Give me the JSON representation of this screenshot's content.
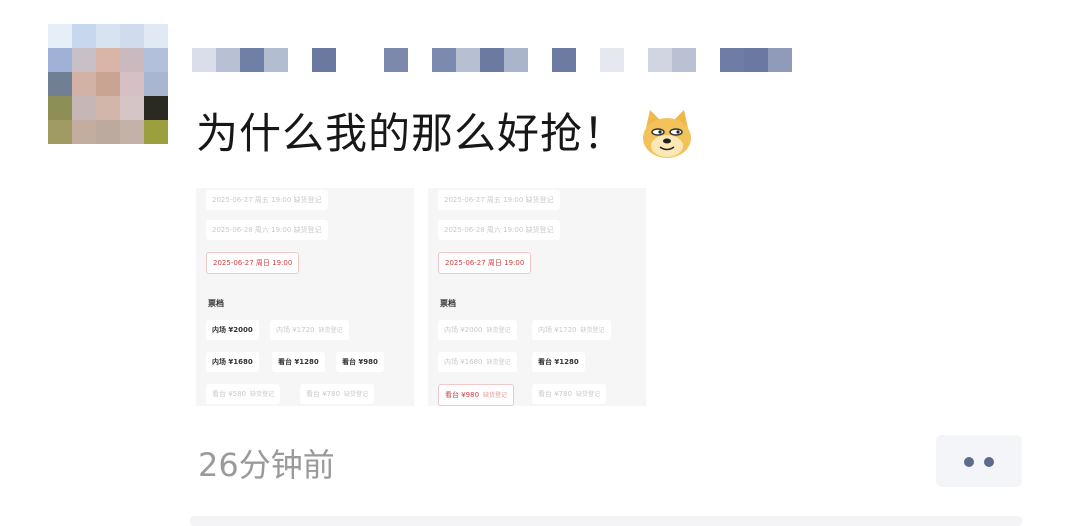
{
  "post": {
    "text": "为什么我的那么好抢！",
    "emoji": "doge-emoji",
    "timestamp": "26分钟前"
  },
  "screenshot_left": {
    "dates": [
      "2025-06-27 周五 19:00 缺货登记",
      "2025-06-28 周六 19:00 缺货登记",
      "2025-06-27 周日 19:00"
    ],
    "section_title": "票档",
    "prices": [
      {
        "label": "内场 ¥2000",
        "tag": ""
      },
      {
        "label": "内场 ¥1720",
        "tag": "缺货登记"
      },
      {
        "label": "内场 ¥1680",
        "tag": ""
      },
      {
        "label": "看台 ¥1280",
        "tag": ""
      },
      {
        "label": "看台 ¥980",
        "tag": ""
      },
      {
        "label": "看台 ¥580",
        "tag": "缺货登记"
      },
      {
        "label": "看台 ¥780",
        "tag": "缺货登记"
      }
    ]
  },
  "screenshot_right": {
    "dates": [
      "2025-06-27 周五 19:00 缺货登记",
      "2025-06-28 周六 19:00 缺货登记",
      "2025-06-27 周日 19:00"
    ],
    "section_title": "票档",
    "prices": [
      {
        "label": "内场 ¥2000",
        "tag": "缺货登记"
      },
      {
        "label": "内场 ¥1720",
        "tag": "缺货登记"
      },
      {
        "label": "内场 ¥1680",
        "tag": "缺货登记"
      },
      {
        "label": "看台 ¥1280",
        "tag": ""
      },
      {
        "label": "看台 ¥980",
        "tag": "缺货登记"
      },
      {
        "label": "看台 ¥780",
        "tag": "缺货登记"
      }
    ]
  },
  "colors": {
    "accent_red": "#d04040",
    "more_button_dots": "#5d6b8c",
    "timestamp": "#9a9a9a"
  },
  "more_button": {
    "icon": "more-dots-icon"
  }
}
